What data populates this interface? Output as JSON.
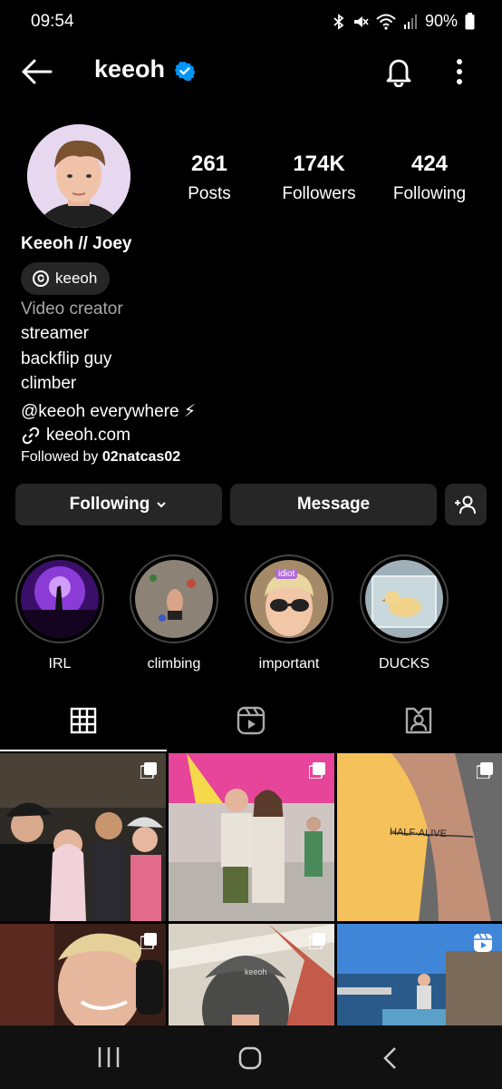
{
  "status_bar": {
    "time": "09:54",
    "battery": "90%"
  },
  "header": {
    "username": "keeoh"
  },
  "stats": [
    {
      "value": "261",
      "label": "Posts"
    },
    {
      "value": "174K",
      "label": "Followers"
    },
    {
      "value": "424",
      "label": "Following"
    }
  ],
  "profile": {
    "display_name": "Keeoh // Joey",
    "threads_handle": "keeoh",
    "category": "Video creator",
    "bio": [
      "streamer",
      "backflip guy",
      "climber",
      "@keeoh everywhere ⚡︎"
    ],
    "link": "keeoh.com",
    "followed_by_prefix": "Followed by ",
    "followed_by_user": "02natcas02"
  },
  "actions": {
    "following_label": "Following",
    "message_label": "Message"
  },
  "highlights": [
    {
      "label": "IRL"
    },
    {
      "label": "climbing"
    },
    {
      "label": "important",
      "sticker": "idiot"
    },
    {
      "label": "DUCKS"
    }
  ],
  "posts": [
    {
      "type": "multi"
    },
    {
      "type": "multi",
      "overlay_text": ""
    },
    {
      "type": "multi",
      "overlay_text": "HALF·ALIVE"
    },
    {
      "type": "multi"
    },
    {
      "type": "multi",
      "overlay_text": "keeoh"
    },
    {
      "type": "reel"
    }
  ],
  "colors": {
    "verified": "#0095f6",
    "button_bg": "#262626",
    "background": "#000000"
  }
}
